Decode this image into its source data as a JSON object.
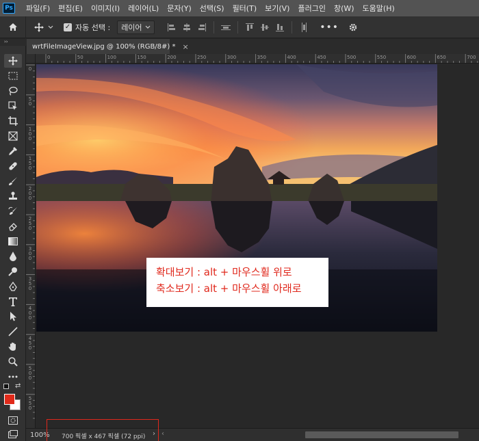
{
  "app": {
    "logo_text": "Ps"
  },
  "menu": [
    "파일(F)",
    "편집(E)",
    "이미지(I)",
    "레이어(L)",
    "문자(Y)",
    "선택(S)",
    "필터(T)",
    "보기(V)",
    "플러그인",
    "창(W)",
    "도움말(H)"
  ],
  "options": {
    "auto_select_label": "자동 선택 :",
    "auto_select_checked": true,
    "target_value": "레이어",
    "more_label": "•••"
  },
  "panel_strip_label": "››",
  "document": {
    "tab_title": "wrtFileImageView.jpg @ 100% (RGB/8#) *",
    "close_label": "×"
  },
  "ruler": {
    "h_labels": [
      "0",
      "50",
      "100",
      "150",
      "200",
      "250",
      "300",
      "350",
      "400",
      "450",
      "500",
      "550",
      "600",
      "650",
      "700"
    ],
    "v_labels": [
      "0",
      "5 0",
      "1 0 0",
      "1 5 0",
      "2 0 0",
      "2 5 0",
      "3 0 0",
      "3 5 0",
      "4 0 0",
      "4 5 0",
      "5 0 0",
      "5 5 0"
    ]
  },
  "caption": {
    "line1": "확대보기 : alt + 마우스휠 위로",
    "line2": "축소보기 : alt + 마우스휠 아래로"
  },
  "status": {
    "zoom": "100%",
    "doc_info": "700 픽셀 x 467 픽셀 (72 ppi)",
    "arrow": "›",
    "scroll_left": "‹"
  },
  "colors": {
    "foreground": "#e02a1a",
    "background": "#ffffff",
    "highlight_outline": "#e0281c",
    "caption_text": "#e0281c"
  },
  "tools": [
    "move-tool-icon",
    "marquee-tool-icon",
    "lasso-tool-icon",
    "object-select-tool-icon",
    "crop-tool-icon",
    "frame-tool-icon",
    "eyedropper-tool-icon",
    "healing-brush-tool-icon",
    "brush-tool-icon",
    "clone-stamp-tool-icon",
    "history-brush-tool-icon",
    "eraser-tool-icon",
    "gradient-tool-icon",
    "blur-tool-icon",
    "dodge-tool-icon",
    "pen-tool-icon",
    "type-tool-icon",
    "path-select-tool-icon",
    "line-tool-icon",
    "hand-tool-icon",
    "zoom-tool-icon",
    "more-tools-icon"
  ]
}
